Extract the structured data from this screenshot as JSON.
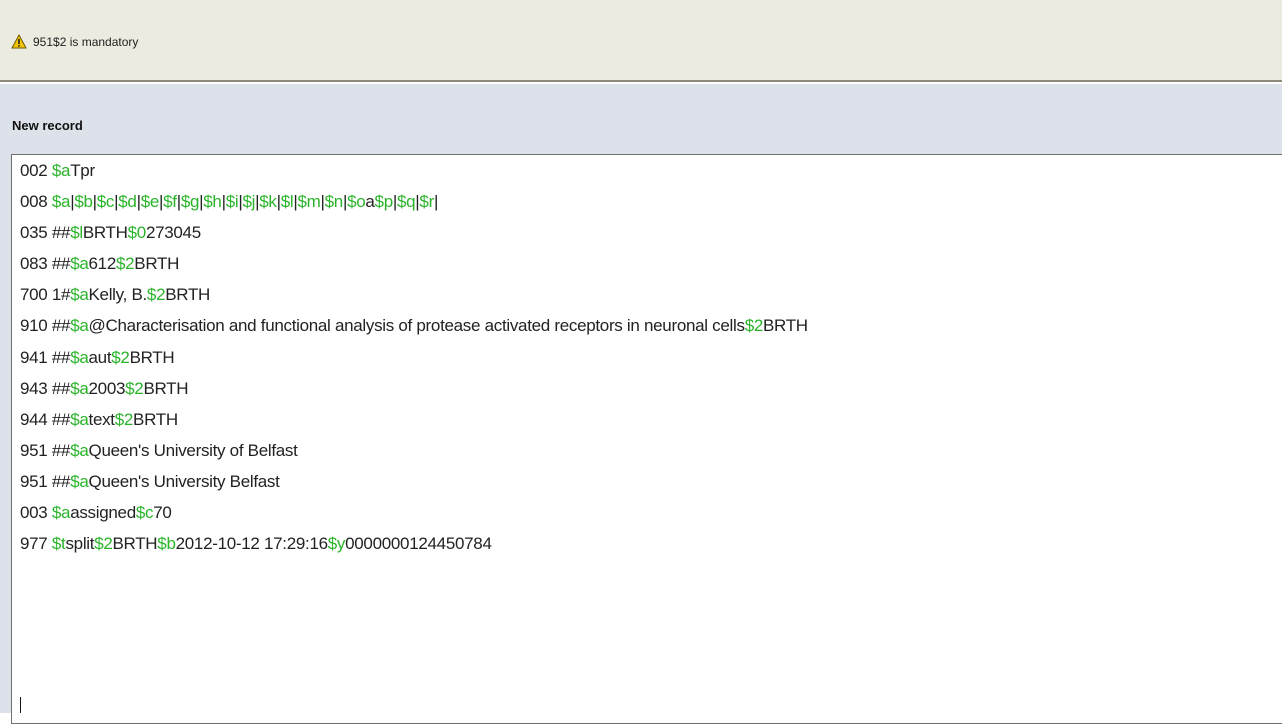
{
  "warning": {
    "icon": "warning-icon",
    "message": "951$2 is mandatory"
  },
  "record": {
    "title": "New record",
    "lines": [
      [
        {
          "t": "002 ",
          "c": false
        },
        {
          "t": "$a",
          "c": true
        },
        {
          "t": "Tpr",
          "c": false
        }
      ],
      [
        {
          "t": "008 ",
          "c": false
        },
        {
          "t": "$a",
          "c": true
        },
        {
          "t": "|",
          "c": false
        },
        {
          "t": "$b",
          "c": true
        },
        {
          "t": "|",
          "c": false
        },
        {
          "t": "$c",
          "c": true
        },
        {
          "t": "|",
          "c": false
        },
        {
          "t": "$d",
          "c": true
        },
        {
          "t": "|",
          "c": false
        },
        {
          "t": "$e",
          "c": true
        },
        {
          "t": "|",
          "c": false
        },
        {
          "t": "$f",
          "c": true
        },
        {
          "t": "|",
          "c": false
        },
        {
          "t": "$g",
          "c": true
        },
        {
          "t": "|",
          "c": false
        },
        {
          "t": "$h",
          "c": true
        },
        {
          "t": "|",
          "c": false
        },
        {
          "t": "$i",
          "c": true
        },
        {
          "t": "|",
          "c": false
        },
        {
          "t": "$j",
          "c": true
        },
        {
          "t": "|",
          "c": false
        },
        {
          "t": "$k",
          "c": true
        },
        {
          "t": "|",
          "c": false
        },
        {
          "t": "$l",
          "c": true
        },
        {
          "t": "|",
          "c": false
        },
        {
          "t": "$m",
          "c": true
        },
        {
          "t": "|",
          "c": false
        },
        {
          "t": "$n",
          "c": true
        },
        {
          "t": "|",
          "c": false
        },
        {
          "t": "$o",
          "c": true
        },
        {
          "t": "a",
          "c": false
        },
        {
          "t": "$p",
          "c": true
        },
        {
          "t": "|",
          "c": false
        },
        {
          "t": "$q",
          "c": true
        },
        {
          "t": "|",
          "c": false
        },
        {
          "t": "$r",
          "c": true
        },
        {
          "t": "|",
          "c": false
        }
      ],
      [
        {
          "t": "035 ##",
          "c": false
        },
        {
          "t": "$l",
          "c": true
        },
        {
          "t": "BRTH",
          "c": false
        },
        {
          "t": "$0",
          "c": true
        },
        {
          "t": "273045",
          "c": false
        }
      ],
      [
        {
          "t": "083 ##",
          "c": false
        },
        {
          "t": "$a",
          "c": true
        },
        {
          "t": "612",
          "c": false
        },
        {
          "t": "$2",
          "c": true
        },
        {
          "t": "BRTH",
          "c": false
        }
      ],
      [
        {
          "t": "700 1#",
          "c": false
        },
        {
          "t": "$a",
          "c": true
        },
        {
          "t": "Kelly, B.",
          "c": false
        },
        {
          "t": "$2",
          "c": true
        },
        {
          "t": "BRTH",
          "c": false
        }
      ],
      [
        {
          "t": "910 ##",
          "c": false
        },
        {
          "t": "$a",
          "c": true
        },
        {
          "t": "@Characterisation and functional analysis of protease activated receptors in neuronal cells",
          "c": false
        },
        {
          "t": "$2",
          "c": true
        },
        {
          "t": "BRTH",
          "c": false
        }
      ],
      [
        {
          "t": "941 ##",
          "c": false
        },
        {
          "t": "$a",
          "c": true
        },
        {
          "t": "aut",
          "c": false
        },
        {
          "t": "$2",
          "c": true
        },
        {
          "t": "BRTH",
          "c": false
        }
      ],
      [
        {
          "t": "943 ##",
          "c": false
        },
        {
          "t": "$a",
          "c": true
        },
        {
          "t": "2003",
          "c": false
        },
        {
          "t": "$2",
          "c": true
        },
        {
          "t": "BRTH",
          "c": false
        }
      ],
      [
        {
          "t": "944 ##",
          "c": false
        },
        {
          "t": "$a",
          "c": true
        },
        {
          "t": "text",
          "c": false
        },
        {
          "t": "$2",
          "c": true
        },
        {
          "t": "BRTH",
          "c": false
        }
      ],
      [
        {
          "t": "951 ##",
          "c": false
        },
        {
          "t": "$a",
          "c": true
        },
        {
          "t": "Queen's University of Belfast",
          "c": false
        }
      ],
      [
        {
          "t": "951 ##",
          "c": false
        },
        {
          "t": "$a",
          "c": true
        },
        {
          "t": "Queen's University Belfast",
          "c": false
        }
      ],
      [
        {
          "t": "003 ",
          "c": false
        },
        {
          "t": "$a",
          "c": true
        },
        {
          "t": "assigned",
          "c": false
        },
        {
          "t": "$c",
          "c": true
        },
        {
          "t": "70",
          "c": false
        }
      ],
      [
        {
          "t": "977 ",
          "c": false
        },
        {
          "t": "$t",
          "c": true
        },
        {
          "t": "split",
          "c": false
        },
        {
          "t": "$2",
          "c": true
        },
        {
          "t": "BRTH",
          "c": false
        },
        {
          "t": "$b",
          "c": true
        },
        {
          "t": "2012-10-12 17:29:16",
          "c": false
        },
        {
          "t": "$y",
          "c": true
        },
        {
          "t": "0000000124450784",
          "c": false
        }
      ]
    ]
  },
  "colors": {
    "subfield": "#2ab42a",
    "warning_bg": "#ecebe0",
    "panel_bg": "#dde2ea"
  }
}
